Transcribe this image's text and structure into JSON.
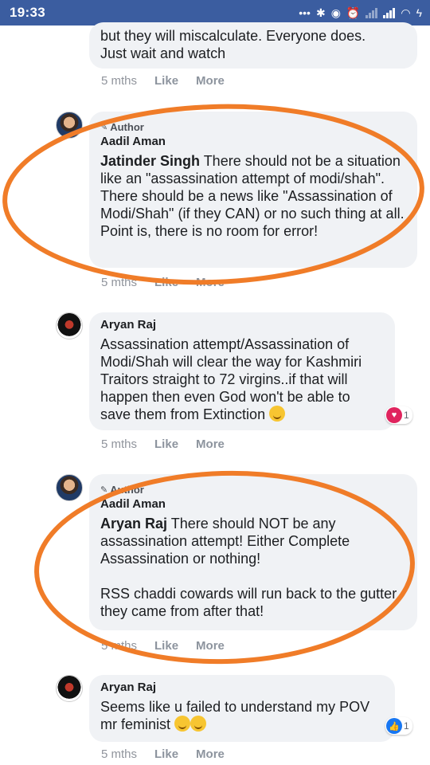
{
  "status_bar": {
    "time": "19:33",
    "indicators": [
      "more-dots-icon",
      "bluetooth-icon",
      "toggle-icon",
      "alarm-icon",
      "signal-icon",
      "signal-icon",
      "wifi-icon",
      "charging-icon"
    ]
  },
  "comments": [
    {
      "id": "c0",
      "body": "but they will miscalculate. Everyone does.\nJust wait and watch",
      "time": "5 mths",
      "like": "Like",
      "more": "More"
    },
    {
      "id": "c1",
      "author_tag": "Author",
      "name": "Aadil Aman",
      "mention": "Jatinder Singh",
      "body": " There should not be a situation like an \"assassination attempt of modi/shah\". There should be a news like \"Assassination of Modi/Shah\" (if they CAN) or no such thing at all.\nPoint is, there is no room for error!",
      "time": "5 mths",
      "like": "Like",
      "more": "More"
    },
    {
      "id": "c2",
      "name": "Aryan Raj",
      "body": "Assassination attempt/Assassination of Modi/Shah will clear the way for Kashmiri Traitors straight to 72 virgins..if that will happen then even God won't be able to save them from Extinction",
      "reaction": "love",
      "reaction_count": "1",
      "time": "5 mths",
      "like": "Like",
      "more": "More"
    },
    {
      "id": "c3",
      "author_tag": "Author",
      "name": "Aadil Aman",
      "mention": "Aryan Raj",
      "body": " There should NOT be any assassination attempt! Either Complete Assassination or nothing!\n\nRSS chaddi cowards will run back to the gutter they came from after that!",
      "time": "5 mths",
      "like": "Like",
      "more": "More"
    },
    {
      "id": "c4",
      "name": "Aryan Raj",
      "body": "Seems like u failed to understand my POV mr feminist",
      "reaction": "like",
      "reaction_count": "1",
      "time": "5 mths",
      "like": "Like",
      "more": "More"
    }
  ],
  "annotation_color": "#f07c28"
}
